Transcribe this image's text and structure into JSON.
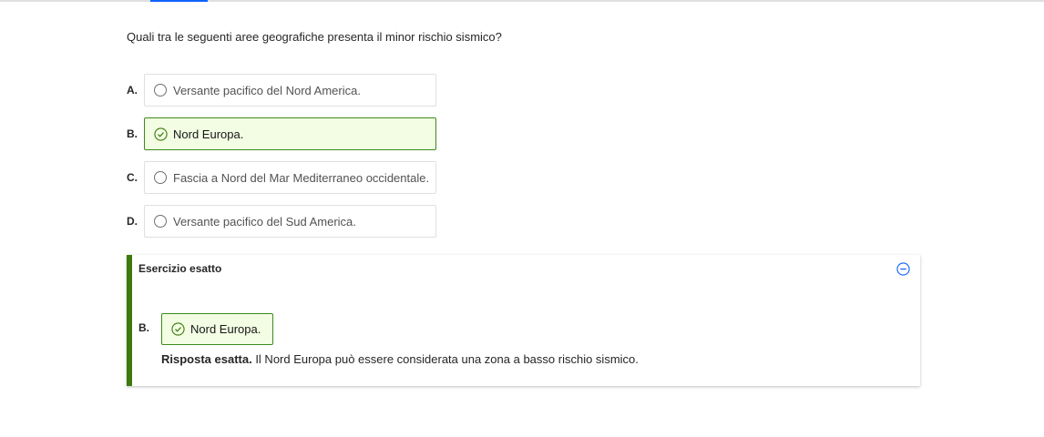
{
  "question": {
    "text": "Quali tra le seguenti aree geografiche presenta il minor rischio sismico?"
  },
  "options": [
    {
      "letter": "A.",
      "text": "Versante pacifico del Nord America.",
      "selected": false
    },
    {
      "letter": "B.",
      "text": "Nord Europa.",
      "selected": true
    },
    {
      "letter": "C.",
      "text": "Fascia a Nord del Mar Mediterraneo occidentale.",
      "selected": false
    },
    {
      "letter": "D.",
      "text": "Versante pacifico del Sud America.",
      "selected": false
    }
  ],
  "feedback": {
    "title": "Esercizio esatto",
    "answer_letter": "B.",
    "answer_text": "Nord Europa.",
    "explanation_label": "Risposta esatta.",
    "explanation_text": " Il Nord Europa può essere considerata una zona a basso rischio sismico."
  },
  "colors": {
    "correct_accent": "#3d7a0e",
    "correct_bg": "#f2fde3",
    "tab_active": "#0f62fe"
  },
  "icons": {
    "radio": "radio-unchecked-icon",
    "check": "check-circle-icon",
    "collapse": "minus-circle-icon"
  }
}
